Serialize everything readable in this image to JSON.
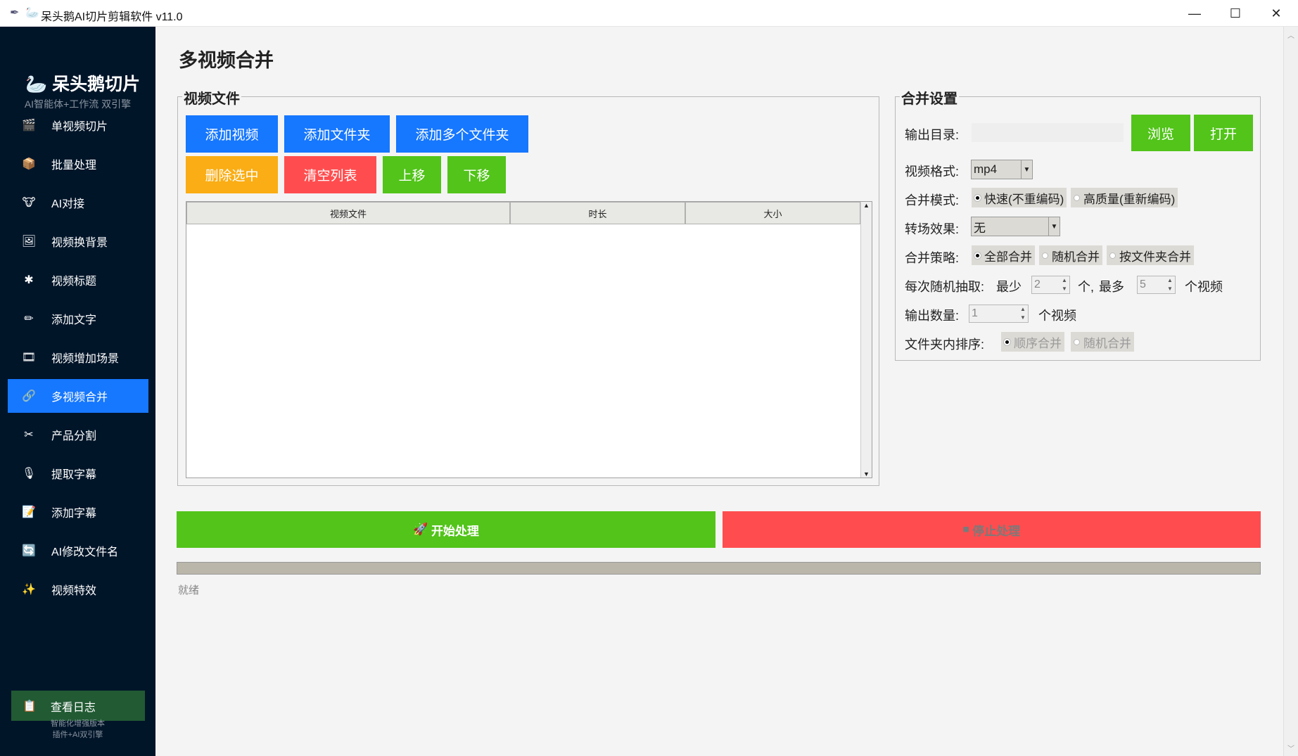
{
  "window": {
    "title": "呆头鹅AI切片剪辑软件 v11.0",
    "minimize": "—",
    "maximize": "☐",
    "close": "✕"
  },
  "sidebar": {
    "logo": "呆头鹅切片",
    "subtitle": "AI智能体+工作流 双引擎",
    "items": [
      {
        "label": "单视频切片",
        "icon": "🎬"
      },
      {
        "label": "批量处理",
        "icon": "📦"
      },
      {
        "label": "AI对接",
        "icon": "🐮"
      },
      {
        "label": "视频换背景",
        "icon": "🖼"
      },
      {
        "label": "视频标题",
        "icon": "✱"
      },
      {
        "label": "添加文字",
        "icon": "✏"
      },
      {
        "label": "视频增加场景",
        "icon": "🎞"
      },
      {
        "label": "多视频合并",
        "icon": "🔗"
      },
      {
        "label": "产品分割",
        "icon": "✂"
      },
      {
        "label": "提取字幕",
        "icon": "🎙"
      },
      {
        "label": "添加字幕",
        "icon": "📝"
      },
      {
        "label": "AI修改文件名",
        "icon": "🔄"
      },
      {
        "label": "视频特效",
        "icon": "✨"
      }
    ],
    "active": "多视频合并",
    "log_button": "查看日志",
    "footer1": "智能化增强版本",
    "footer2": "插件+AI双引擎"
  },
  "main": {
    "title": "多视频合并",
    "files": {
      "group": "视频文件",
      "add_video": "添加视频",
      "add_folder": "添加文件夹",
      "add_folders": "添加多个文件夹",
      "delete": "删除选中",
      "clear": "清空列表",
      "up": "上移",
      "down": "下移",
      "columns": [
        "视频文件",
        "时长",
        "大小"
      ]
    },
    "settings": {
      "group": "合并设置",
      "output_dir_label": "输出目录:",
      "output_dir": "",
      "browse": "浏览",
      "open": "打开",
      "format_label": "视频格式:",
      "format": "mp4",
      "mode_label": "合并模式:",
      "mode_fast": "快速(不重编码)",
      "mode_hq": "高质量(重新编码)",
      "transition_label": "转场效果:",
      "transition": "无",
      "strategy_label": "合并策略:",
      "strategy_all": "全部合并",
      "strategy_random": "随机合并",
      "strategy_folder": "按文件夹合并",
      "random_label": "每次随机抽取:",
      "min_label": "最少",
      "min": "2",
      "unit1": "个,",
      "max_label": "最多",
      "max": "5",
      "unit2": "个视频",
      "count_label": "输出数量:",
      "count": "1",
      "unit3": "个视频",
      "sort_label": "文件夹内排序:",
      "sort_seq": "顺序合并",
      "sort_random": "随机合并"
    },
    "start": "开始处理",
    "stop": "停止处理",
    "progress": 0,
    "status": "就绪"
  },
  "colors": {
    "sidebar": "#011529",
    "active": "#1677ff",
    "blue": "#1677ff",
    "orange": "#faad14",
    "red": "#ff4d4f",
    "green": "#52c41a"
  }
}
